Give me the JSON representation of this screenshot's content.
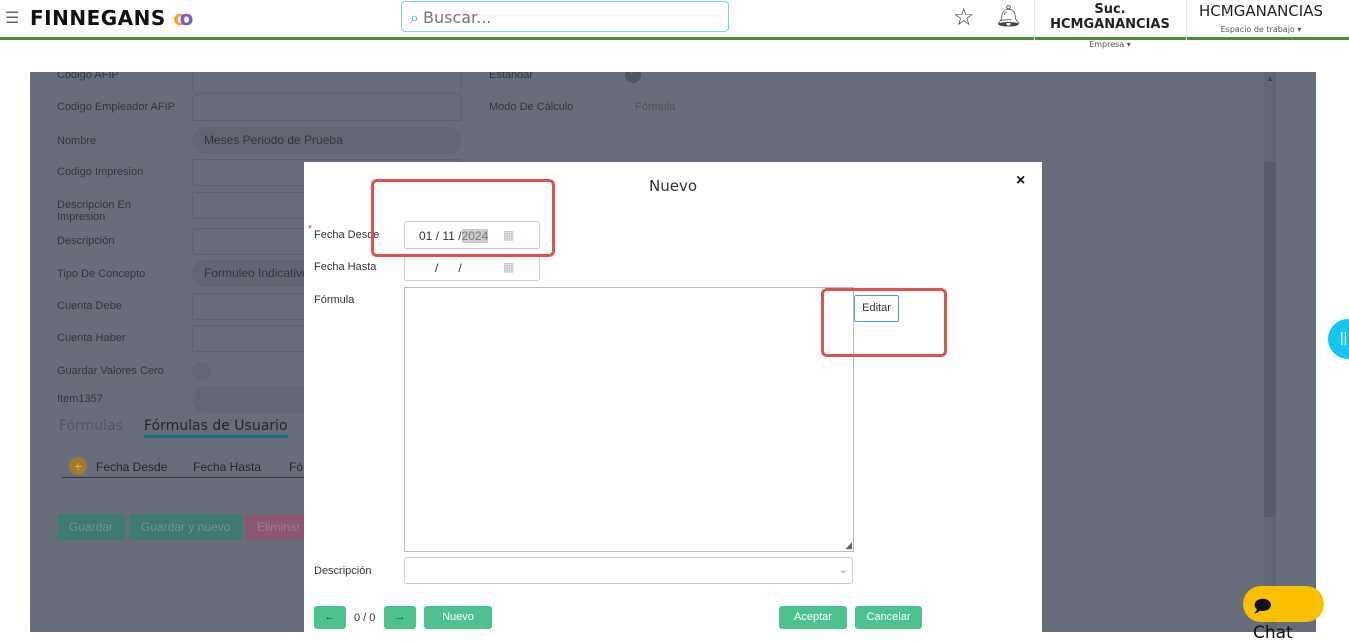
{
  "header": {
    "logo": "FINNEGANS",
    "search_placeholder": "Buscar...",
    "company": "Suc. HCMGANANCIAS",
    "company_label": "Empresa ▾",
    "workspace": "HCMGANANCIAS",
    "workspace_label": "Espacio de trabajo ▾"
  },
  "background_form": {
    "fields": [
      {
        "label": "Codigo AFIP",
        "value": ""
      },
      {
        "label": "Codigo Empleador AFIP",
        "value": ""
      },
      {
        "label": "Nombre",
        "value": "Meses Periodo de Prueba"
      },
      {
        "label": "Codigo Impresion",
        "value": ""
      },
      {
        "label": "Descripcion En Impresion",
        "value": ""
      },
      {
        "label": "Descripción",
        "value": ""
      },
      {
        "label": "Tipo De Concepto",
        "value": "Formuleo Indicativo"
      },
      {
        "label": "Cuenta Debe",
        "value": ""
      },
      {
        "label": "Cuenta Haber",
        "value": ""
      },
      {
        "label": "Guardar Valores Cero",
        "value": ""
      },
      {
        "label": "Item1357",
        "value": ""
      }
    ],
    "right_fields": [
      {
        "label": "Estandar"
      },
      {
        "label": "Modo De Cálculo",
        "value": "Fórmula"
      }
    ],
    "tabs": [
      "Fórmulas",
      "Fórmulas de Usuario"
    ],
    "columns": [
      "Fecha Desde",
      "Fecha Hasta",
      "Fó"
    ],
    "buttons": {
      "save": "Guardar",
      "save_new": "Guardar y nuevo",
      "delete": "Eliminar"
    }
  },
  "modal": {
    "title": "Nuevo",
    "close": "×",
    "required_mark": "*",
    "fecha_desde_label": "Fecha Desde",
    "fecha_desde": {
      "day": "01",
      "month": "11",
      "year": "2024"
    },
    "fecha_hasta_label": "Fecha Hasta",
    "date_sep": "/",
    "formula_label": "Fórmula",
    "editar": "Editar",
    "descripcion_label": "Descripción",
    "pager": "0 / 0",
    "nuevo": "Nuevo",
    "aceptar": "Aceptar",
    "cancelar": "Cancelar"
  },
  "chat": "Chat"
}
